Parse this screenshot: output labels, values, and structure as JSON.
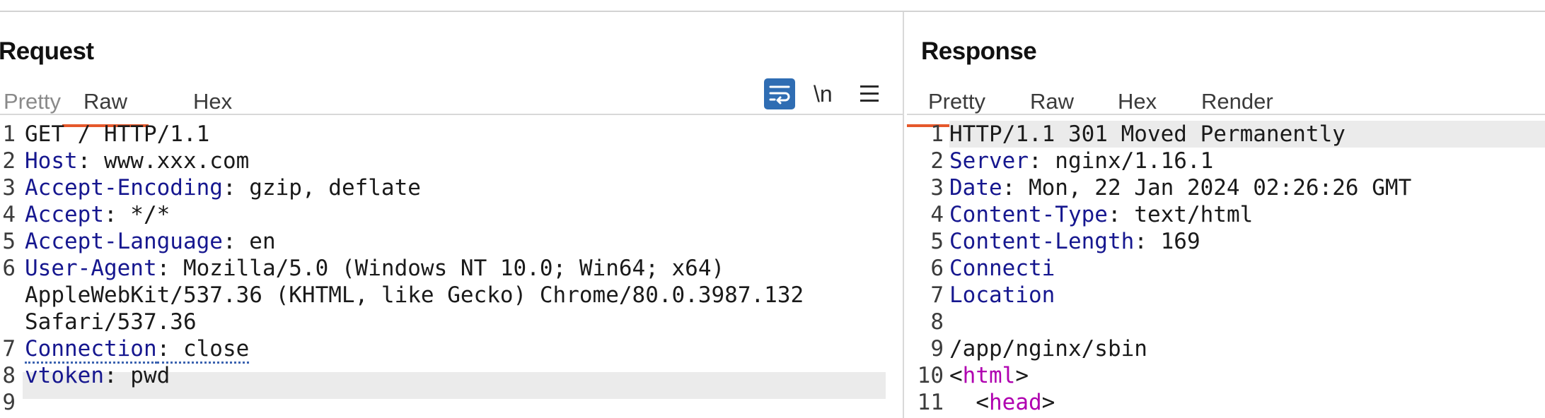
{
  "request": {
    "title": "Request",
    "tabs": [
      {
        "label": "Pretty",
        "active": false
      },
      {
        "label": "Raw",
        "active": true
      },
      {
        "label": "Hex",
        "active": false
      }
    ],
    "toolbar": {
      "wrap_icon": "wrap-lines-icon",
      "newline_label": "\\n",
      "menu_icon": "hamburger-menu-icon"
    },
    "lines": [
      {
        "num": "1",
        "key": "",
        "text": "GET / HTTP/1.1"
      },
      {
        "num": "2",
        "key": "Host",
        "text": ": www.xxx.com"
      },
      {
        "num": "3",
        "key": "Accept-Encoding",
        "text": ": gzip, deflate"
      },
      {
        "num": "4",
        "key": "Accept",
        "text": ": */*"
      },
      {
        "num": "5",
        "key": "Accept-Language",
        "text": ": en"
      },
      {
        "num": "6",
        "key": "User-Agent",
        "text": ": Mozilla/5.0 (Windows NT 10.0; Win64; x64)"
      },
      {
        "num": "",
        "key": "",
        "text": "AppleWebKit/537.36 (KHTML, like Gecko) Chrome/80.0.3987.132"
      },
      {
        "num": "",
        "key": "",
        "text": "Safari/537.36"
      },
      {
        "num": "7",
        "key": "Connection",
        "text": ": close"
      },
      {
        "num": "8",
        "key": "vtoken",
        "text": ": pwd"
      },
      {
        "num": "9",
        "key": "",
        "text": ""
      }
    ]
  },
  "response": {
    "title": "Response",
    "tabs": [
      {
        "label": "Pretty",
        "active": true
      },
      {
        "label": "Raw",
        "active": false
      },
      {
        "label": "Hex",
        "active": false
      },
      {
        "label": "Render",
        "active": false
      }
    ],
    "lines": [
      {
        "num": "1",
        "key": "",
        "text": "HTTP/1.1 301 Moved Permanently"
      },
      {
        "num": "2",
        "key": "Server",
        "text": ": nginx/1.16.1"
      },
      {
        "num": "3",
        "key": "Date",
        "text": ": Mon, 22 Jan 2024 02:26:26 GMT"
      },
      {
        "num": "4",
        "key": "Content-Type",
        "text": ": text/html"
      },
      {
        "num": "5",
        "key": "Content-Length",
        "text": ": 169"
      },
      {
        "num": "6",
        "key": "Connecti",
        "text": ""
      },
      {
        "num": "7",
        "key": "Location",
        "text": ""
      },
      {
        "num": "8",
        "key": "",
        "text": ""
      },
      {
        "num": "9",
        "key": "",
        "text": "/app/nginx/sbin"
      },
      {
        "num": "10",
        "pre": "<",
        "tag": "html",
        "post": ">"
      },
      {
        "num": "11",
        "pre": "  <",
        "tag": "head",
        "post": ">"
      }
    ]
  },
  "colors": {
    "accent_underline": "#e5582b",
    "header_key": "#16178f",
    "html_tag": "#b000b0",
    "wrap_button": "#2f6db3"
  }
}
